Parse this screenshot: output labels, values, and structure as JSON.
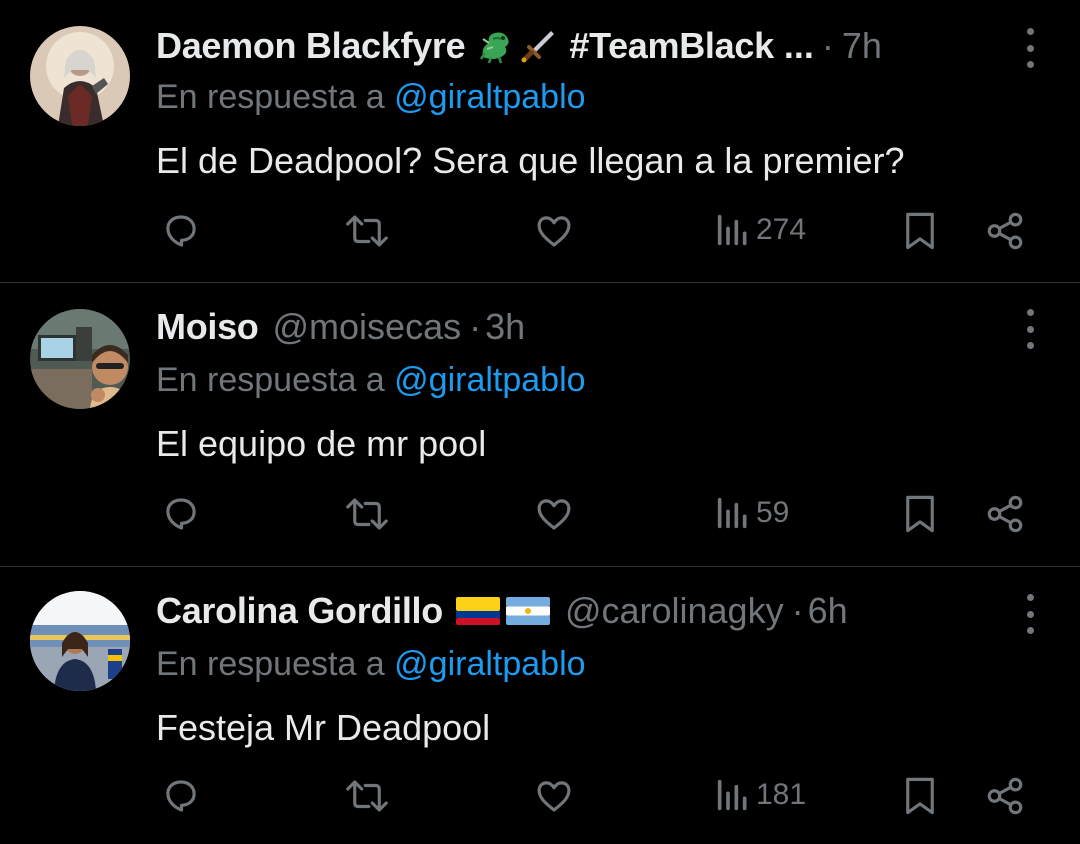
{
  "colors": {
    "background": "#000000",
    "primary_text": "#e7e9ea",
    "secondary_text": "#71767b",
    "mention": "#1d9bf0",
    "divider": "#2f3336"
  },
  "icons": [
    "comment-icon",
    "retweet-icon",
    "like-icon",
    "views-icon",
    "bookmark-icon",
    "share-icon",
    "more-options-icon",
    "dragon-emoji",
    "dagger-emoji",
    "colombia-flag-emoji",
    "argentina-flag-emoji"
  ],
  "tweets": [
    {
      "name": "Daemon Blackfyre",
      "tag": "#TeamBlack",
      "ellipsis": "...",
      "handle": "",
      "dot": "·",
      "time": "7h",
      "reply_prefix": "En respuesta a",
      "reply_mention": "@giraltpablo",
      "text": "El de Deadpool? Sera que llegan a la premier?",
      "views": "274"
    },
    {
      "name": "Moiso",
      "tag": "",
      "ellipsis": "",
      "handle": "@moisecas",
      "dot": "·",
      "time": "3h",
      "reply_prefix": "En respuesta a",
      "reply_mention": "@giraltpablo",
      "text": "El equipo de mr pool",
      "views": "59"
    },
    {
      "name": "Carolina Gordillo",
      "tag": "",
      "ellipsis": "",
      "handle": "@carolinagky",
      "dot": "·",
      "time": "6h",
      "reply_prefix": "En respuesta a",
      "reply_mention": "@giraltpablo",
      "text": "Festeja Mr Deadpool",
      "views": "181"
    }
  ]
}
